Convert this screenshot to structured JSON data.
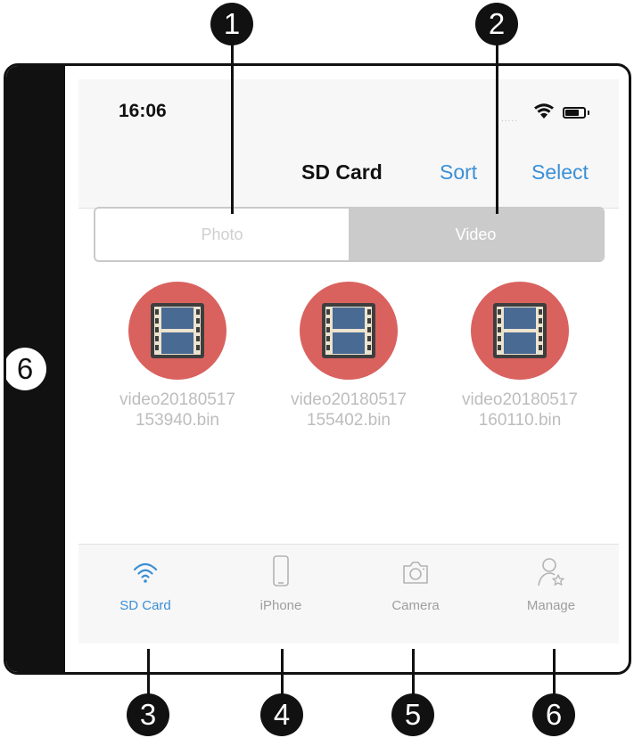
{
  "status_bar": {
    "time": "16:06",
    "signal": "....."
  },
  "nav": {
    "title": "SD Card",
    "sort": "Sort",
    "select": "Select"
  },
  "segments": {
    "photo": "Photo",
    "video": "Video",
    "selected": "Video"
  },
  "files": [
    {
      "name": "video20180517\n153940.bin",
      "icon": "film-icon"
    },
    {
      "name": "video20180517\n155402.bin",
      "icon": "film-icon"
    },
    {
      "name": "video20180517\n160110.bin",
      "icon": "film-icon"
    }
  ],
  "tabs": [
    {
      "label": "SD Card",
      "icon": "wifi-icon",
      "active": true
    },
    {
      "label": "iPhone",
      "icon": "phone-icon",
      "active": false
    },
    {
      "label": "Camera",
      "icon": "camera-icon",
      "active": false
    },
    {
      "label": "Manage",
      "icon": "user-star-icon",
      "active": false
    }
  ],
  "callouts": {
    "c1": "1",
    "c2": "2",
    "c3": "3",
    "c4": "4",
    "c5": "5",
    "c6_bottom": "6",
    "c6_side": "6"
  },
  "colors": {
    "accent": "#3a8fd6",
    "file_icon_bg": "#d9625f",
    "frame": "#111111"
  }
}
